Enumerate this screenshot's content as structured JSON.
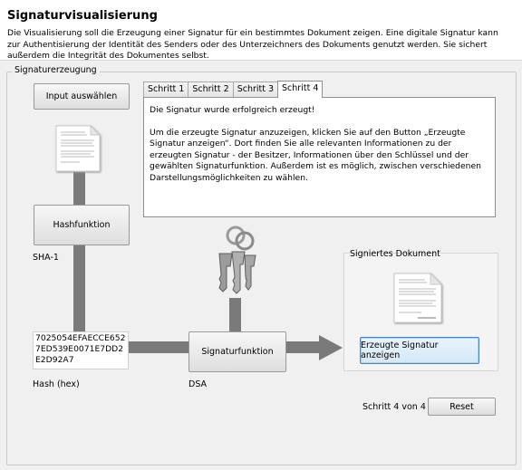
{
  "header": {
    "title": "Signaturvisualisierung",
    "description": "Die Visualisierung soll die Erzeugung einer Signatur für ein bestimmtes Dokument zeigen. Eine digitale Signatur kann zur Authentisierung der Identität des Senders oder des Unterzeichners des Dokuments genutzt werden. Sie sichert außerdem die Integrität des Dokumentes selbst."
  },
  "group": {
    "label": "Signaturerzeugung"
  },
  "input_button": "Input auswählen",
  "hash_button": "Hashfunktion",
  "hash_algo": "SHA-1",
  "hash_value": "7025054EFAECCE6527ED539E0071E7DD2E2D92A7",
  "hash_label": "Hash (hex)",
  "sig_button": "Signaturfunktion",
  "sig_algo": "DSA",
  "tabs": [
    {
      "label": "Schritt 1"
    },
    {
      "label": "Schritt 2"
    },
    {
      "label": "Schritt 3"
    },
    {
      "label": "Schritt 4"
    }
  ],
  "tab_content": {
    "line1": "Die Signatur wurde erfolgreich erzeugt!",
    "line2": "Um die erzeugte Signatur anzuzeigen, klicken Sie auf den Button „Erzeugte Signatur anzeigen“. Dort finden Sie alle relevanten Informationen zu der erzeugten Signatur - der Besitzer, Informationen über den Schlüssel und der gewählten Signaturfunktion. Außerdem ist es möglich, zwischen verschiedenen Darstellungsmöglichkeiten zu wählen."
  },
  "signed_doc": {
    "label": "Signiertes Dokument",
    "button": "Erzeugte Signatur anzeigen"
  },
  "step_status": "Schritt 4 von 4",
  "reset_button": "Reset",
  "icons": [
    "document-icon",
    "keys-icon",
    "signed-document-icon",
    "arrow-right-icon"
  ]
}
